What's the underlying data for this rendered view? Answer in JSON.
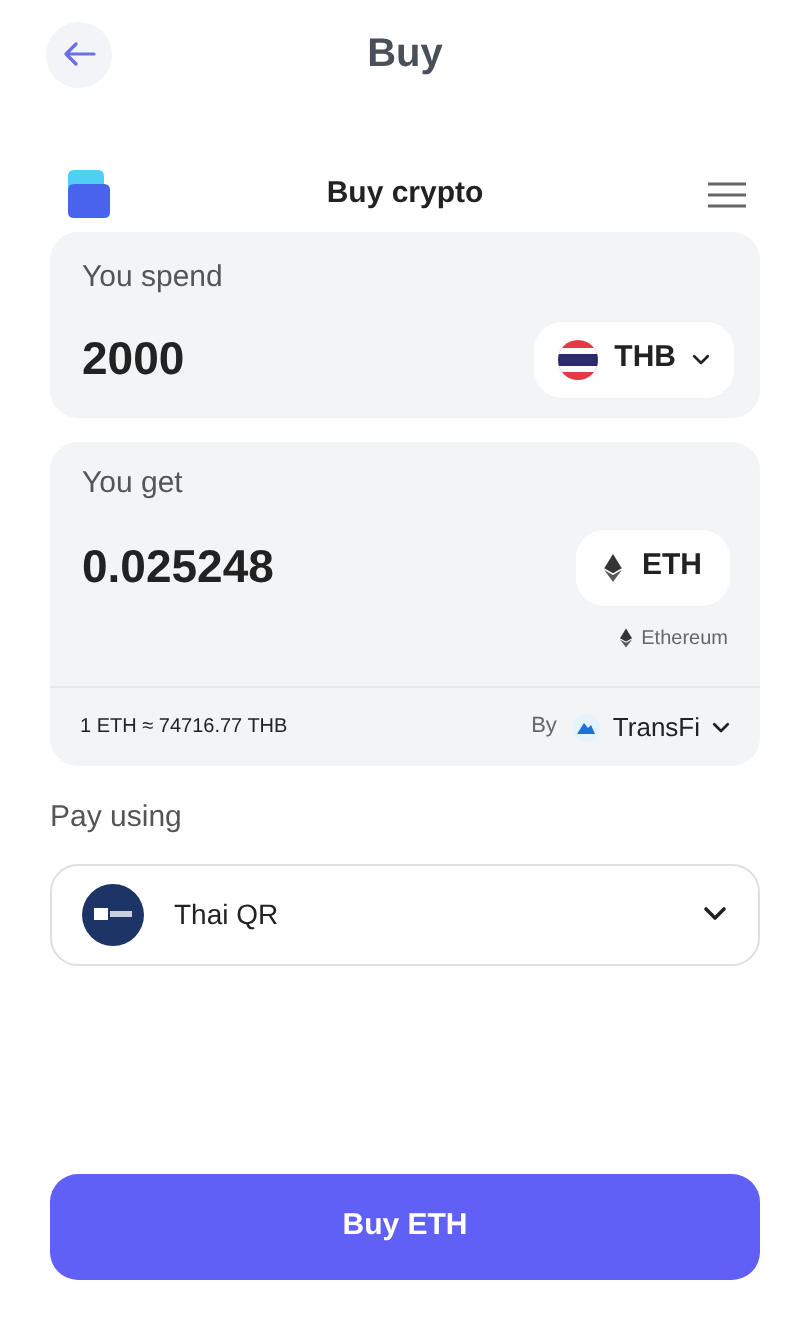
{
  "header": {
    "title": "Buy"
  },
  "widget": {
    "title": "Buy crypto"
  },
  "spend": {
    "label": "You spend",
    "amount": "2000",
    "currency": "THB"
  },
  "get": {
    "label": "You get",
    "amount": "0.025248",
    "currency": "ETH",
    "network": "Ethereum",
    "rate": "1 ETH ≈ 74716.77 THB",
    "by_label": "By",
    "provider": "TransFi"
  },
  "pay": {
    "label": "Pay using",
    "method": "Thai QR"
  },
  "action": {
    "label": "Buy ETH"
  }
}
